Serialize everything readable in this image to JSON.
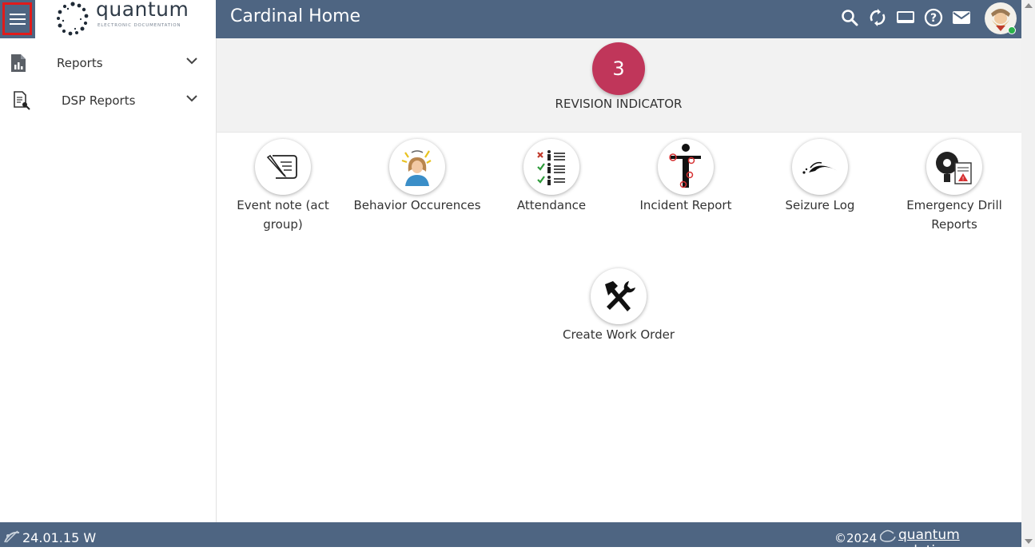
{
  "header": {
    "logo_text": "quantum",
    "logo_sub": "ELECTRONIC DOCUMENTATION",
    "title": "Cardinal Home",
    "icons": [
      "search-icon",
      "sync-icon",
      "display-icon",
      "help-icon",
      "mail-icon"
    ]
  },
  "sidebar": {
    "items": [
      {
        "label": "Reports",
        "icon": "report-chart-icon"
      },
      {
        "label": "DSP Reports",
        "icon": "document-search-icon"
      }
    ]
  },
  "revision": {
    "count": "3",
    "label": "REVISION INDICATOR"
  },
  "tiles": [
    {
      "label": "Event note (act group)",
      "icon": "note-pen-icon"
    },
    {
      "label": "Behavior Occurences",
      "icon": "stressed-person-icon"
    },
    {
      "label": "Attendance",
      "icon": "attendance-checklist-icon"
    },
    {
      "label": "Incident Report",
      "icon": "body-figure-icon"
    },
    {
      "label": "Seizure Log",
      "icon": "seizure-wave-icon"
    },
    {
      "label": "Emergency Drill Reports",
      "icon": "alarm-bell-icon"
    },
    {
      "label": "Create Work Order",
      "icon": "tools-icon"
    }
  ],
  "footer": {
    "version": "24.01.15 W",
    "copyright": "©2024",
    "brand": "quantum solutions"
  },
  "colors": {
    "topbar": "#4e6582",
    "revision_circle": "#c0365a",
    "highlight_border": "#e01b1b"
  }
}
